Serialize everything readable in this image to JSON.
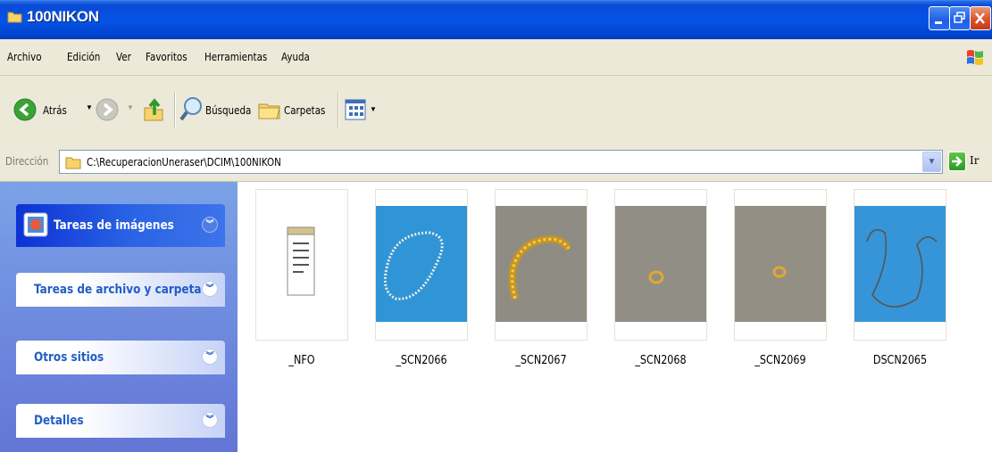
{
  "window": {
    "title": "100NIKON"
  },
  "menu": [
    "Archivo",
    "Edición",
    "Ver",
    "Favoritos",
    "Herramientas",
    "Ayuda"
  ],
  "toolbar": {
    "back_label": "Atrás",
    "search_label": "Búsqueda",
    "folders_label": "Carpetas"
  },
  "address": {
    "label": "Dirección",
    "path": "C:\\RecuperacionUneraser\\DCIM\\100NIKON",
    "go_label": "Ir"
  },
  "task_pane": {
    "panels": [
      {
        "title": "Tareas de imágenes"
      },
      {
        "title": "Tareas de archivo y carpeta"
      },
      {
        "title": "Otros sitios"
      },
      {
        "title": "Detalles"
      }
    ]
  },
  "files": [
    {
      "name": "_NFO",
      "kind": "text-document"
    },
    {
      "name": "_SCN2066",
      "kind": "photo-pearl-necklace"
    },
    {
      "name": "_SCN2067",
      "kind": "photo-gold-bracelet"
    },
    {
      "name": "_SCN2068",
      "kind": "photo-gold-ring"
    },
    {
      "name": "_SCN2069",
      "kind": "photo-gold-ring"
    },
    {
      "name": "DSCN2065",
      "kind": "photo-chain-necklace"
    }
  ],
  "colors": {
    "titlebar": "#0553e6",
    "taskpane": "#7ba2e7",
    "accent": "#215dc6",
    "photo_blue": "#2f95d6",
    "photo_gray": "#8f8c84"
  }
}
